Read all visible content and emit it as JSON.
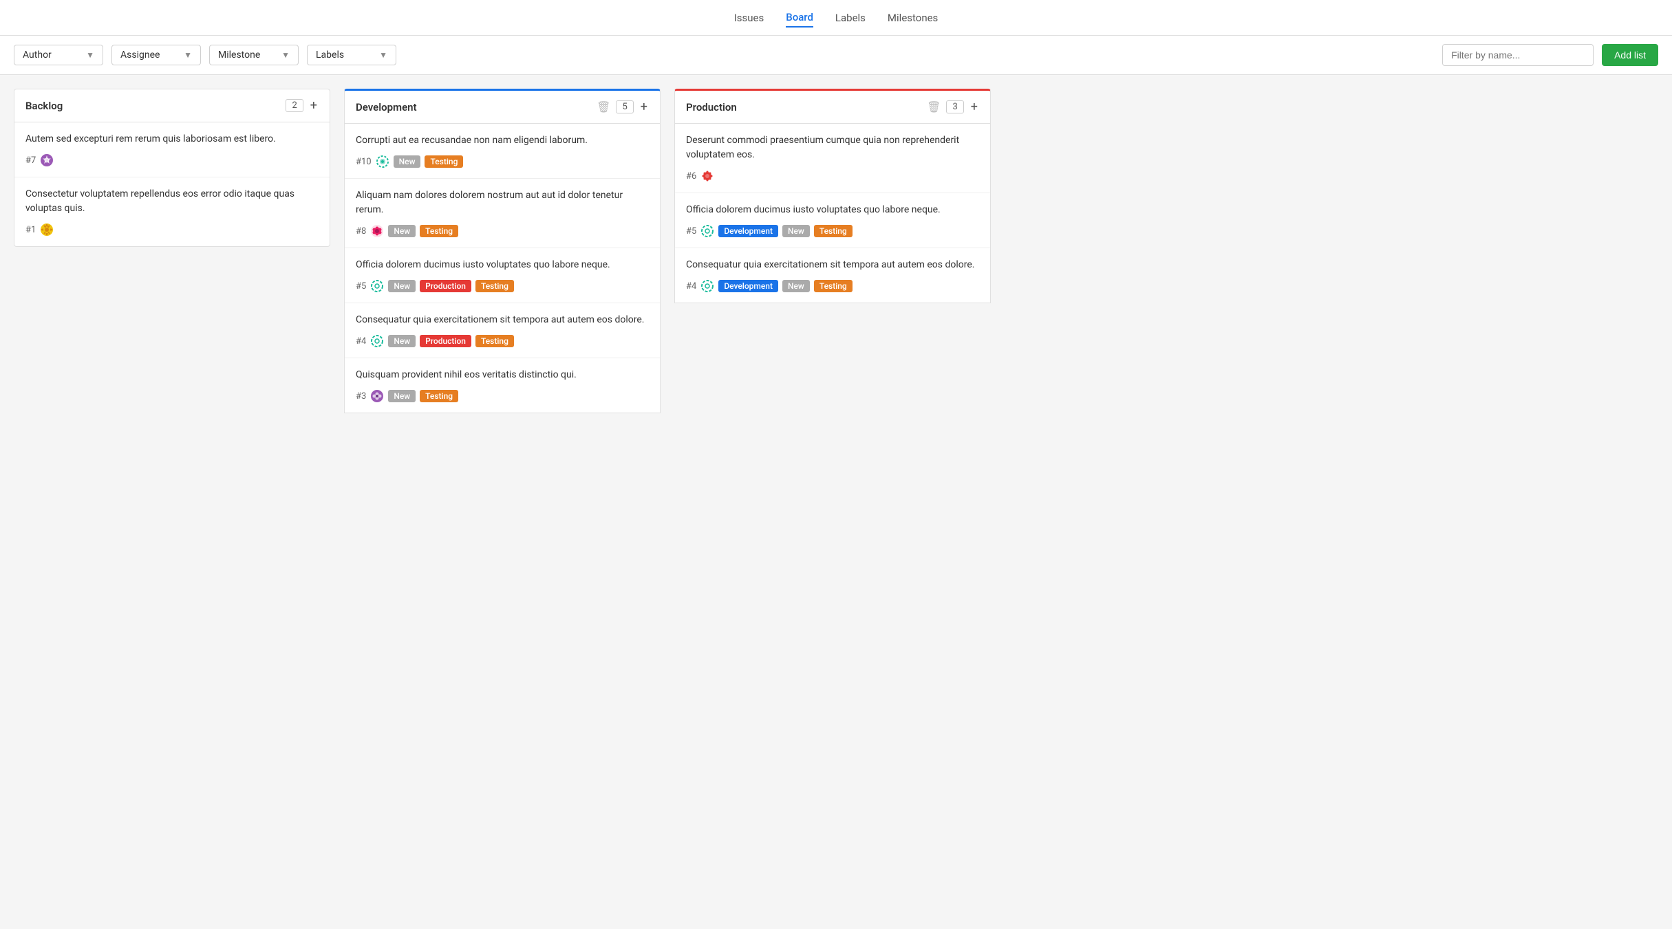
{
  "nav": {
    "items": [
      {
        "label": "Issues",
        "active": false
      },
      {
        "label": "Board",
        "active": true
      },
      {
        "label": "Labels",
        "active": false
      },
      {
        "label": "Milestones",
        "active": false
      }
    ]
  },
  "filters": {
    "author_label": "Author",
    "assignee_label": "Assignee",
    "milestone_label": "Milestone",
    "labels_label": "Labels",
    "filter_placeholder": "Filter by name...",
    "add_list_label": "Add list"
  },
  "columns": [
    {
      "id": "backlog",
      "title": "Backlog",
      "count": 2,
      "top_color": "none",
      "cards": [
        {
          "id": "c1",
          "title": "Autem sed excepturi rem rerum quis laboriosam est libero.",
          "num": "#7",
          "avatar_type": "purple-star",
          "labels": []
        },
        {
          "id": "c2",
          "title": "Consectetur voluptatem repellendus eos error odio itaque quas voluptas quis.",
          "num": "#1",
          "avatar_type": "yellow-star",
          "labels": []
        }
      ]
    },
    {
      "id": "development",
      "title": "Development",
      "count": 5,
      "top_color": "blue",
      "cards": [
        {
          "id": "c3",
          "title": "Corrupti aut ea recusandae non nam eligendi laborum.",
          "num": "#10",
          "avatar_type": "teal-circle",
          "labels": [
            "New",
            "Testing"
          ]
        },
        {
          "id": "c4",
          "title": "Aliquam nam dolores dolorem nostrum aut aut id dolor tenetur rerum.",
          "num": "#8",
          "avatar_type": "pink-flower",
          "labels": [
            "New",
            "Testing"
          ]
        },
        {
          "id": "c5",
          "title": "Officia dolorem ducimus iusto voluptates quo labore neque.",
          "num": "#5",
          "avatar_type": "teal-dashed",
          "labels": [
            "New",
            "Production",
            "Testing"
          ]
        },
        {
          "id": "c6",
          "title": "Consequatur quia exercitationem sit tempora aut autem eos dolore.",
          "num": "#4",
          "avatar_type": "teal-dashed",
          "labels": [
            "New",
            "Production",
            "Testing"
          ]
        },
        {
          "id": "c7",
          "title": "Quisquam provident nihil eos veritatis distinctio qui.",
          "num": "#3",
          "avatar_type": "purple-circle",
          "labels": [
            "New",
            "Testing"
          ]
        }
      ]
    },
    {
      "id": "production",
      "title": "Production",
      "count": 3,
      "top_color": "red",
      "cards": [
        {
          "id": "c8",
          "title": "Deserunt commodi praesentium cumque quia non reprehenderit voluptatem eos.",
          "num": "#6",
          "avatar_type": "red-virus",
          "labels": []
        },
        {
          "id": "c9",
          "title": "Officia dolorem ducimus iusto voluptates quo labore neque.",
          "num": "#5",
          "avatar_type": "teal-dashed",
          "labels": [
            "Development",
            "New",
            "Testing"
          ]
        },
        {
          "id": "c10",
          "title": "Consequatur quia exercitationem sit tempora aut autem eos dolore.",
          "num": "#4",
          "avatar_type": "teal-dashed",
          "labels": [
            "Development",
            "New",
            "Testing"
          ]
        }
      ]
    }
  ]
}
